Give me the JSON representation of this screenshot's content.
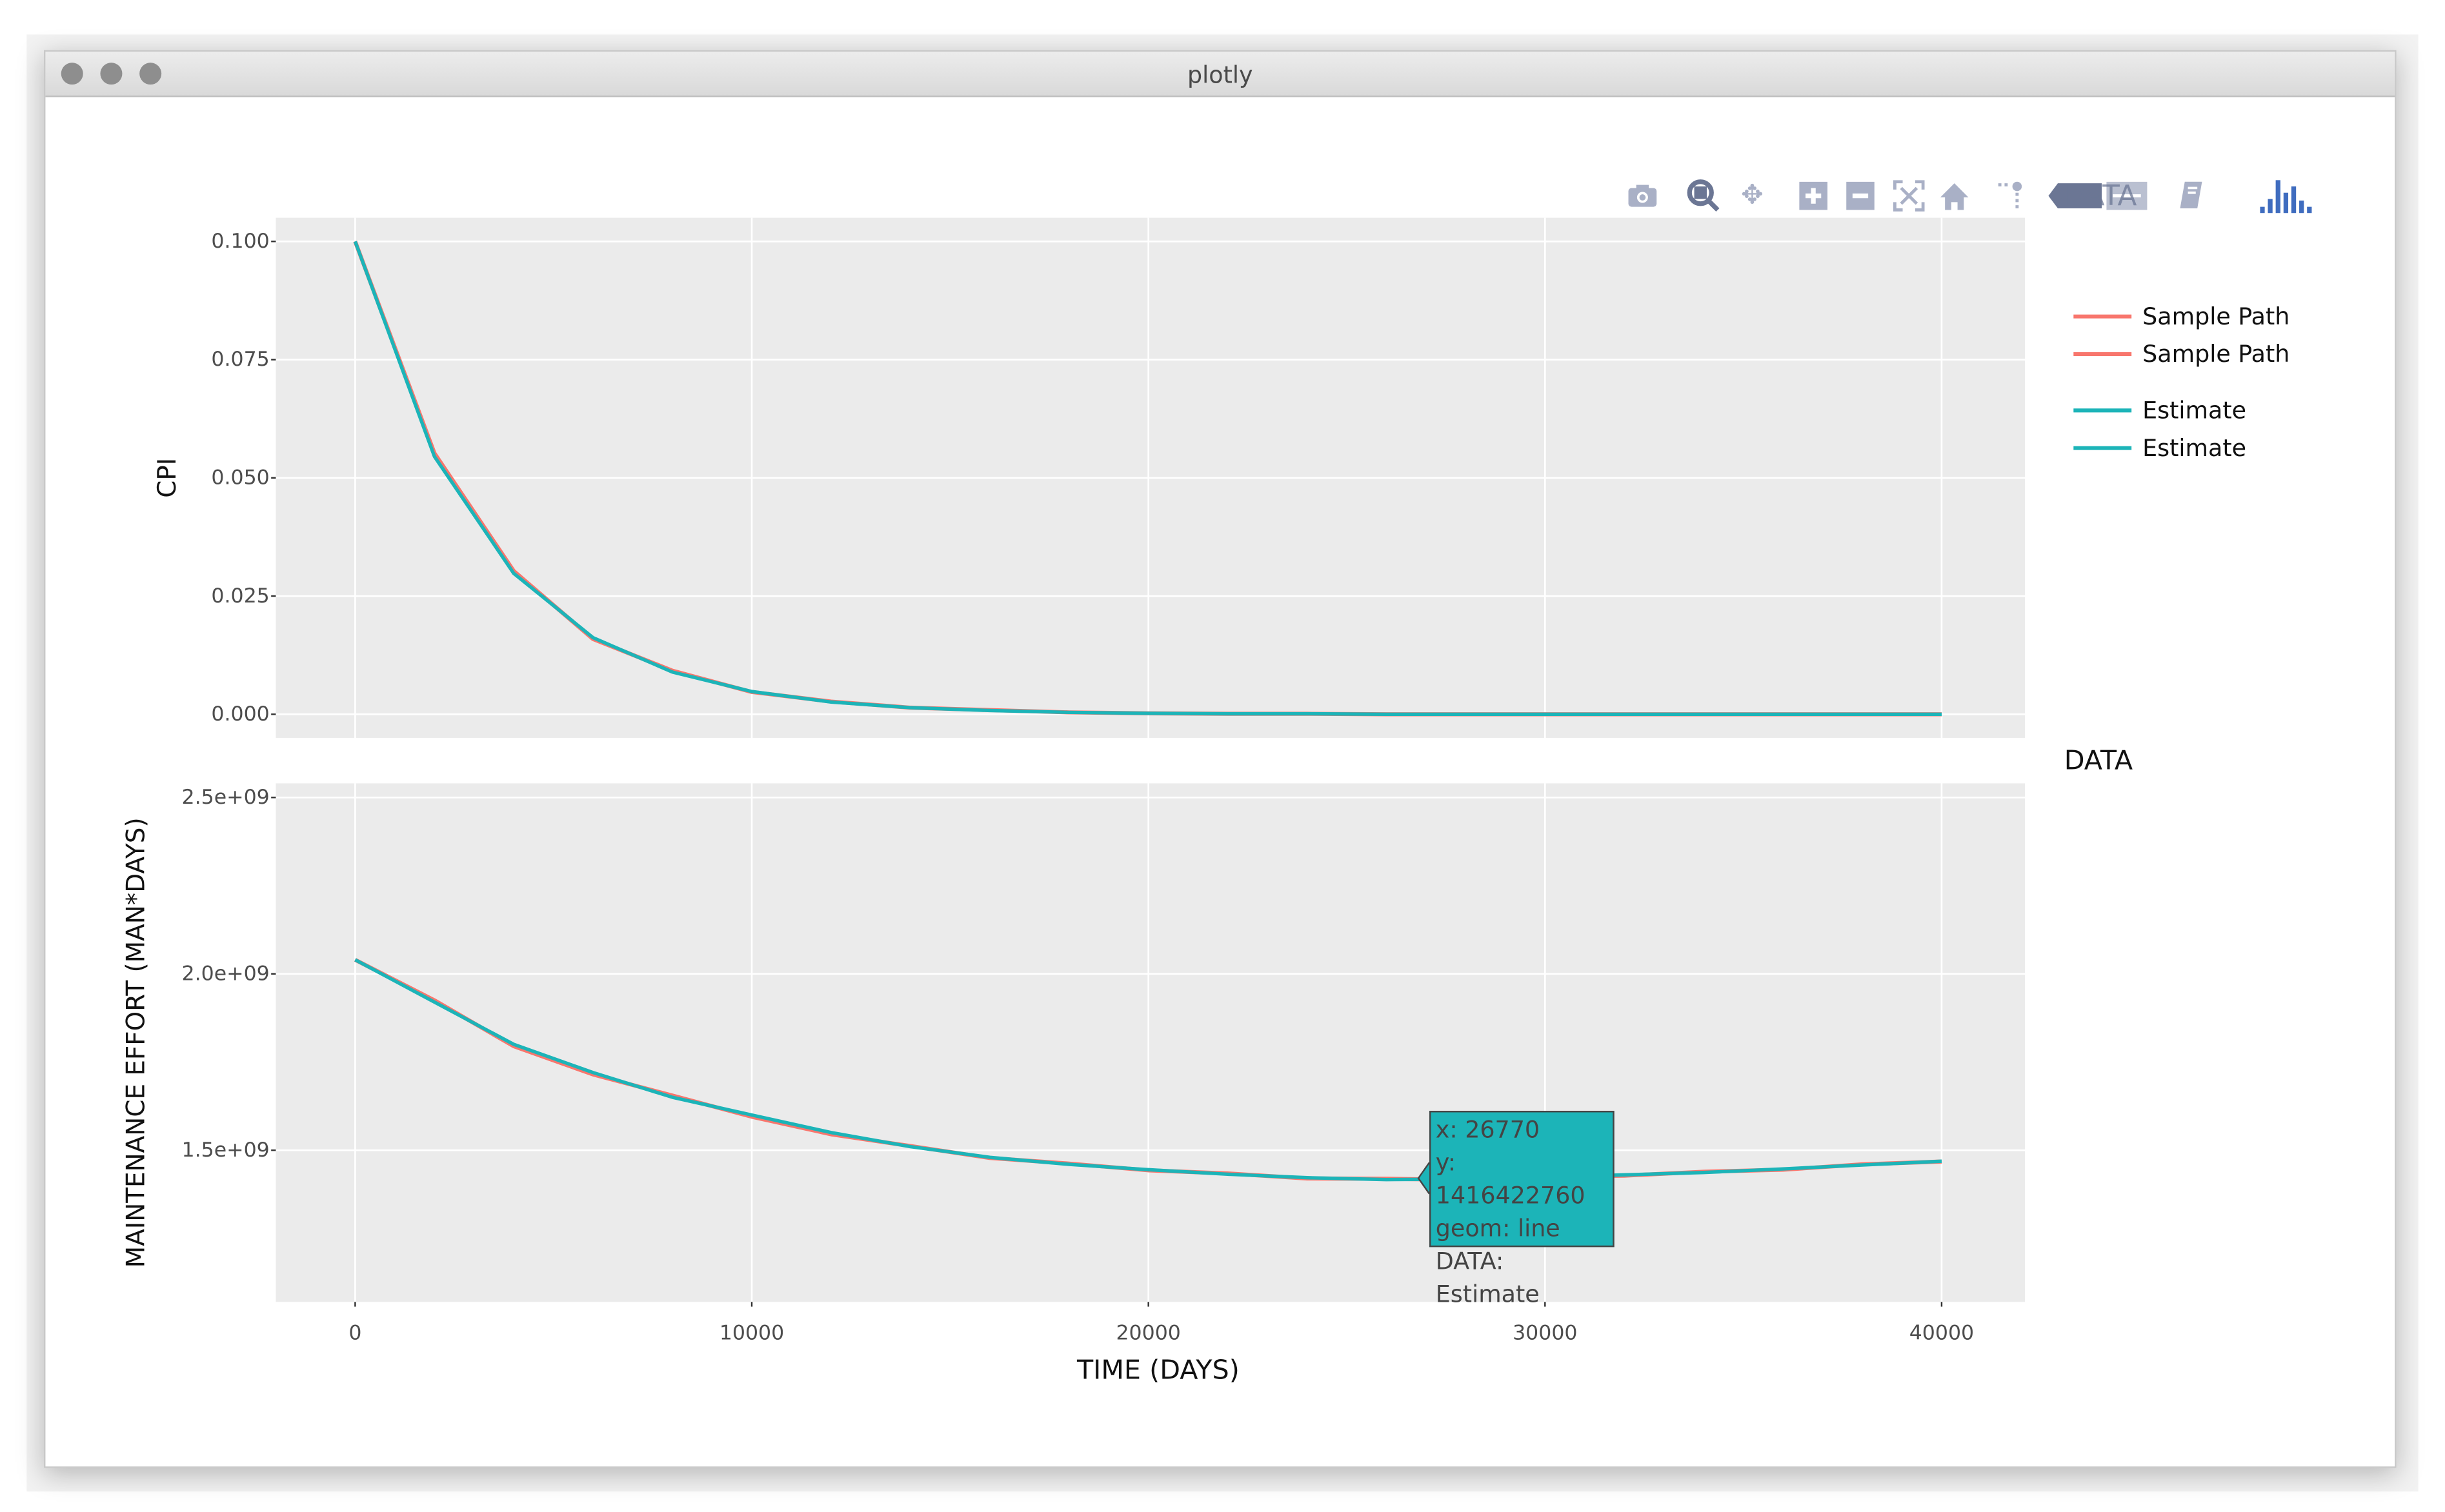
{
  "window": {
    "title": "plotly"
  },
  "toolbar": {
    "buttons": [
      "camera-icon",
      "zoom-icon",
      "pan-icon",
      "zoom-in-icon",
      "zoom-out-icon",
      "autoscale-icon",
      "home-icon",
      "spike-lines-icon",
      "hover-closest-icon",
      "hover-compare-icon",
      "edit-chart-icon",
      "plotly-logo-icon"
    ],
    "overlap_text": "DATA"
  },
  "legend": {
    "title": "DATA",
    "items": [
      {
        "label": "Sample Path",
        "color": "#F8766D"
      },
      {
        "label": "Sample Path",
        "color": "#F8766D"
      },
      {
        "label": "Estimate",
        "color": "#1CB4B8"
      },
      {
        "label": "Estimate",
        "color": "#1CB4B8"
      }
    ]
  },
  "tooltip": {
    "x": "x: 26770",
    "y": "y: 1416422760",
    "geom": "geom: line",
    "data": "DATA: Estimate",
    "color": "#1CB4B8"
  },
  "chart_data": [
    {
      "type": "line",
      "title": "",
      "xlabel": "",
      "ylabel": "CPI",
      "xlim": [
        -2000,
        42100
      ],
      "ylim": [
        -0.005,
        0.105
      ],
      "yticks": [
        0,
        0.025,
        0.05,
        0.075,
        0.1
      ],
      "ytick_labels": [
        "0.000",
        "0.025",
        "0.050",
        "0.075",
        "0.100"
      ],
      "grid": true,
      "x": [
        0,
        2000,
        4000,
        6000,
        8000,
        10000,
        12000,
        14000,
        16000,
        18000,
        20000,
        22000,
        24000,
        26000,
        28000,
        30000,
        32000,
        34000,
        36000,
        38000,
        40000
      ],
      "series": [
        {
          "name": "Sample Path",
          "values": [
            0.1,
            0.0552,
            0.0303,
            0.0159,
            0.0092,
            0.0047,
            0.0027,
            0.0014,
            0.0009,
            0.0004,
            0.0002,
            0.0001,
            0.0001,
            0,
            0,
            0,
            0,
            0,
            0,
            0,
            0
          ]
        },
        {
          "name": "Estimate",
          "values": [
            0.1,
            0.0545,
            0.0298,
            0.0162,
            0.0089,
            0.0048,
            0.0026,
            0.0014,
            0.0008,
            0.0004,
            0.0002,
            0.0001,
            0.0001,
            0,
            0,
            0,
            0,
            0,
            0,
            0,
            0
          ]
        }
      ]
    },
    {
      "type": "line",
      "title": "",
      "xlabel": "TIME (DAYS)",
      "ylabel": "MAINTENANCE EFFORT (MAN*DAYS)",
      "xlim": [
        -2000,
        42100
      ],
      "ylim": [
        1070000000,
        2540000000
      ],
      "xticks": [
        0,
        10000,
        20000,
        30000,
        40000
      ],
      "xtick_labels": [
        "0",
        "10000",
        "20000",
        "30000",
        "40000"
      ],
      "yticks": [
        1500000000,
        2000000000,
        2500000000
      ],
      "ytick_labels": [
        "1.5e+09",
        "2.0e+09",
        "2.5e+09"
      ],
      "grid": true,
      "x": [
        0,
        2000,
        4000,
        6000,
        8000,
        10000,
        12000,
        14000,
        16000,
        18000,
        20000,
        22000,
        24000,
        26000,
        28000,
        30000,
        32000,
        34000,
        36000,
        38000,
        40000
      ],
      "series": [
        {
          "name": "Sample Path",
          "values": [
            2040000000,
            1925000000,
            1795000000,
            1715000000,
            1655000000,
            1595000000,
            1545000000,
            1512000000,
            1478000000,
            1462000000,
            1443000000,
            1434000000,
            1420000000,
            1419000000,
            1416000000,
            1425000000,
            1428000000,
            1439000000,
            1445000000,
            1460000000,
            1468000000
          ]
        },
        {
          "name": "Estimate",
          "values": [
            2040000000,
            1920000000,
            1800000000,
            1720000000,
            1650000000,
            1600000000,
            1550000000,
            1510000000,
            1480000000,
            1460000000,
            1445000000,
            1432000000,
            1422000000,
            1417000000,
            1418000000,
            1423000000,
            1430000000,
            1437000000,
            1447000000,
            1458000000,
            1469000000
          ]
        }
      ]
    }
  ]
}
